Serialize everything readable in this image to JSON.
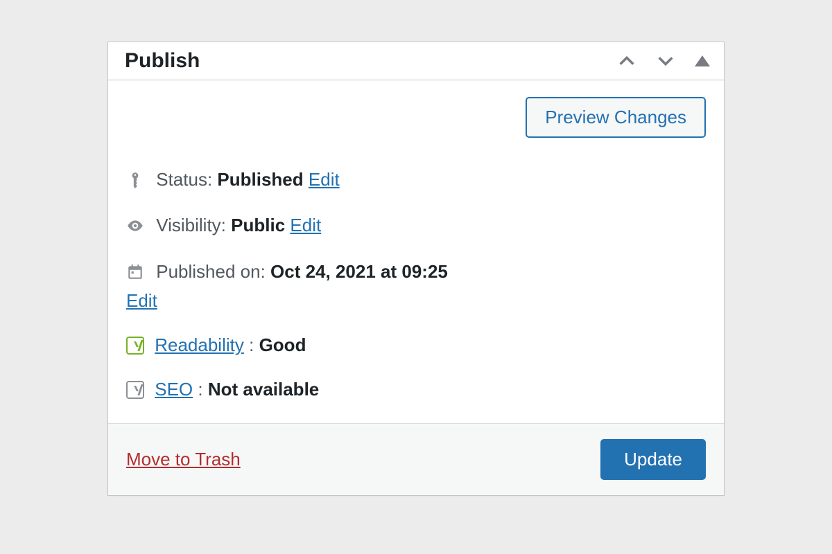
{
  "panel": {
    "title": "Publish",
    "preview_button": "Preview Changes",
    "status": {
      "label": "Status:",
      "value": "Published",
      "edit": "Edit"
    },
    "visibility": {
      "label": "Visibility:",
      "value": "Public",
      "edit": "Edit"
    },
    "published_on": {
      "label": "Published on:",
      "value": "Oct 24, 2021 at 09:25",
      "edit": "Edit"
    },
    "readability": {
      "link": "Readability",
      "sep": ":",
      "value": "Good"
    },
    "seo": {
      "link": "SEO",
      "sep": ":",
      "value": "Not available"
    },
    "trash": "Move to Trash",
    "update": "Update"
  }
}
